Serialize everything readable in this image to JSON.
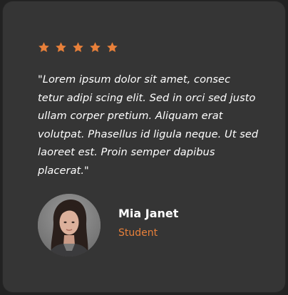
{
  "testimonial": {
    "rating": 5,
    "rating_max": 5,
    "star_color": "#e8803a",
    "star_icon": "star-icon",
    "quote": "\"Lorem ipsum dolor sit amet, consec tetur adipi scing elit. Sed in orci sed justo ullam corper pretium. Aliquam erat volutpat. Phasellus id ligula neque. Ut sed laoreet est. Proin semper dapibus placerat.\"",
    "author": {
      "name": "Mia Janet",
      "role": "Student",
      "role_color": "#e8803a"
    }
  },
  "colors": {
    "page_background": "#222222",
    "card_background": "#353535",
    "text": "#ffffff",
    "accent": "#e8803a"
  }
}
